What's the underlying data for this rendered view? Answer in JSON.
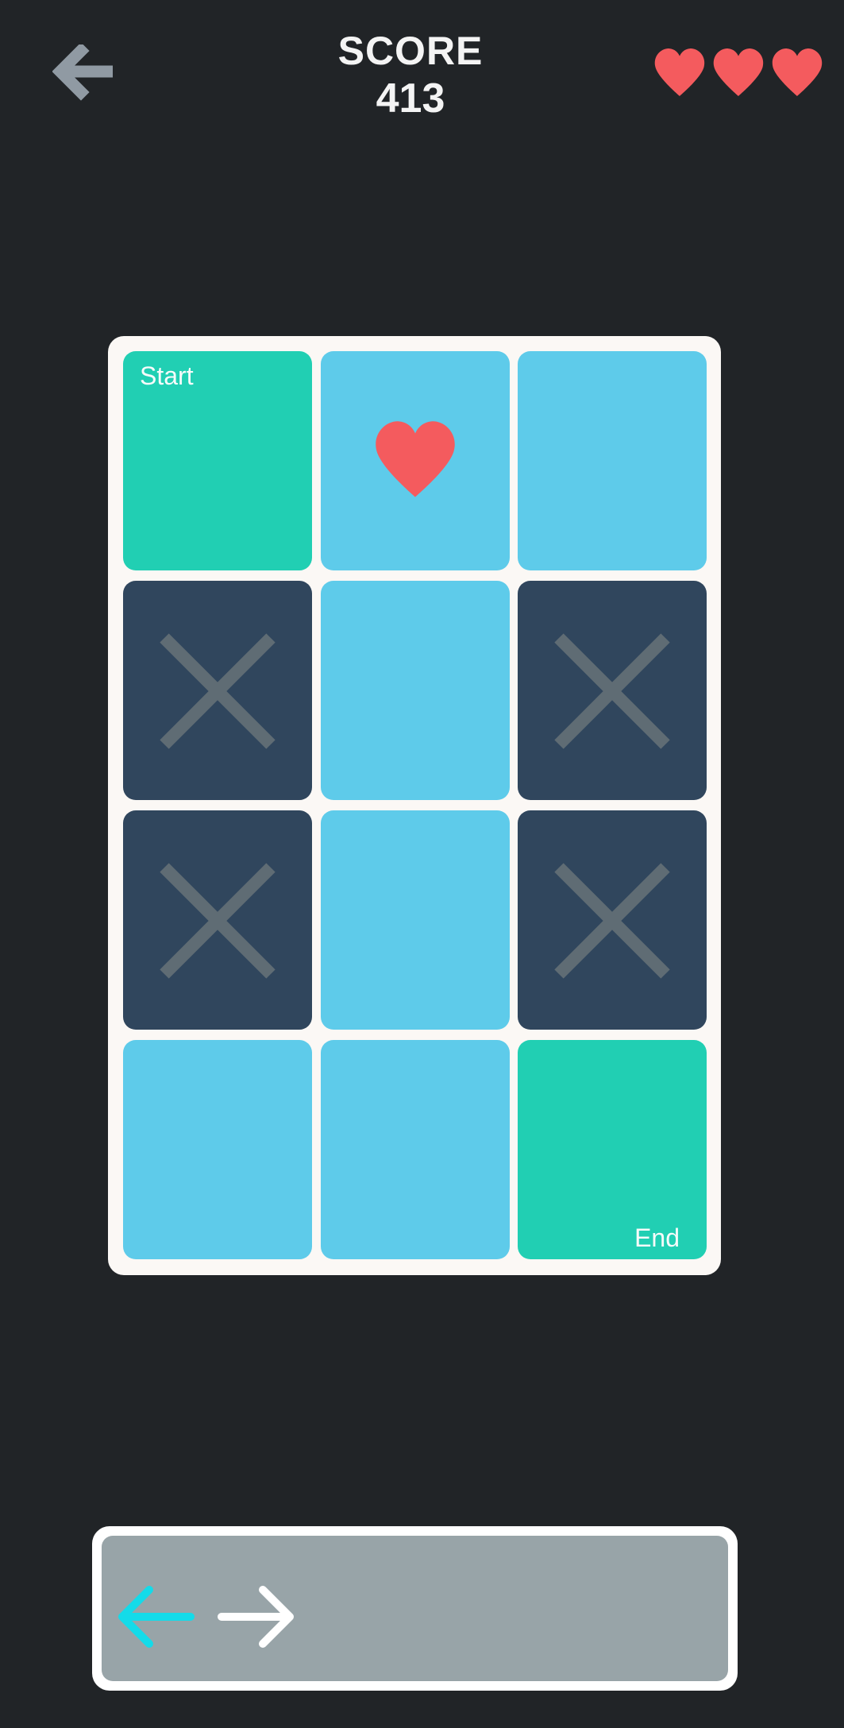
{
  "header": {
    "score_label": "SCORE",
    "score_value": "413",
    "back_icon": "arrow-left-icon",
    "lives": 3,
    "life_icon": "heart-icon"
  },
  "board": {
    "rows": 4,
    "columns": 3,
    "tiles": [
      [
        "start",
        "heart",
        "path"
      ],
      [
        "blocked",
        "path",
        "blocked"
      ],
      [
        "blocked",
        "path",
        "blocked"
      ],
      [
        "path",
        "path",
        "end"
      ]
    ],
    "start_label": "Start",
    "end_label": "End"
  },
  "moves": [
    "left",
    "right"
  ],
  "colors": {
    "background": "#212427",
    "board": "#fbf8f5",
    "path_tile": "#5ecbea",
    "endpoint_tile": "#21cfb3",
    "blocked_tile": "#30465d",
    "blocked_mark": "#5f6c74",
    "heart": "#f45b5e",
    "back_arrow": "#909aa3",
    "moves_panel": "#98a4a8",
    "move_active": "#14dbe9",
    "move_inactive": "#ffffff"
  }
}
